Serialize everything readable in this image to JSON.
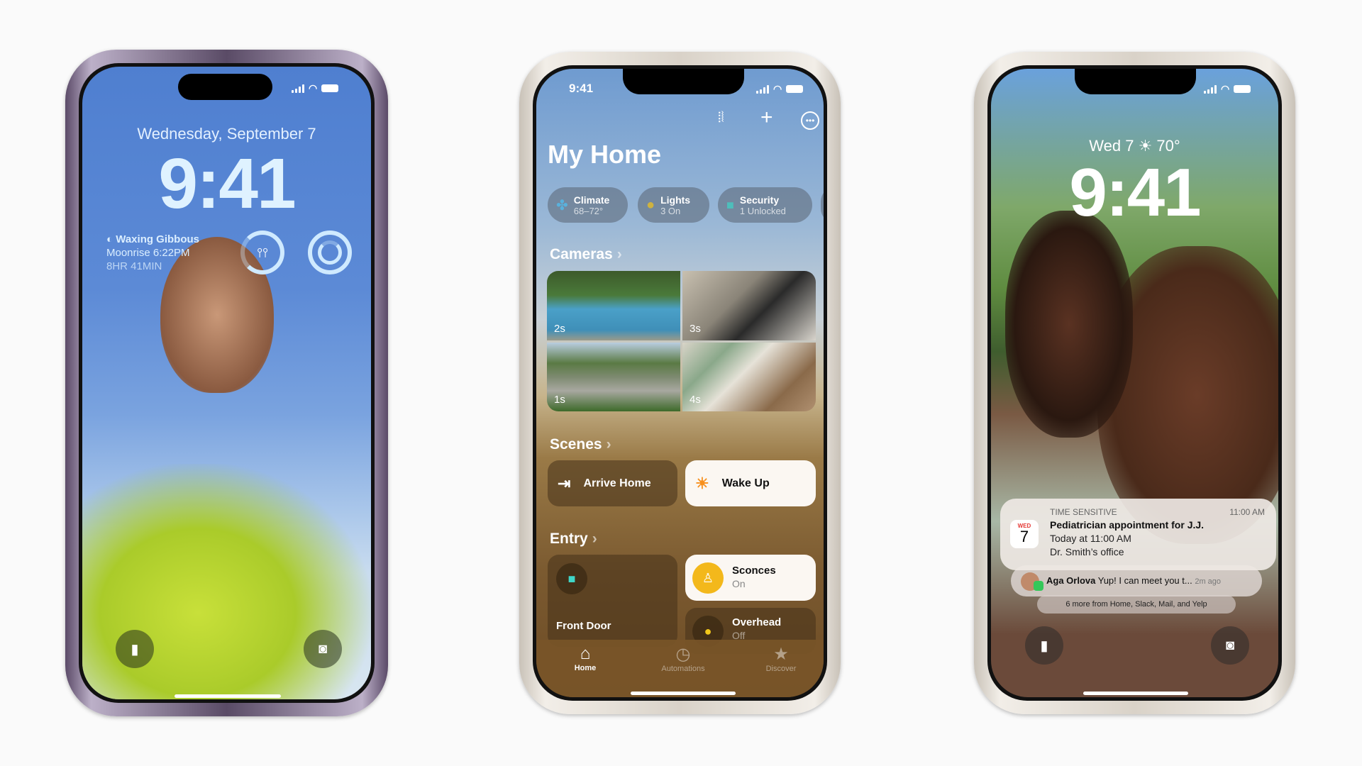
{
  "phone_left": {
    "date": "Wednesday, September 7",
    "time": "9:41",
    "widget": {
      "title": "Waxing Gibbous",
      "line2": "Moonrise 6:22PM",
      "line3": "8HR 41MIN"
    }
  },
  "phone_center": {
    "status_time": "9:41",
    "title": "My Home",
    "chips": [
      {
        "label": "Climate",
        "value": "68–72°",
        "icon": "fan-icon",
        "color": "#4fc3f7"
      },
      {
        "label": "Lights",
        "value": "3 On",
        "icon": "lightbulb-icon",
        "color": "#f5c518"
      },
      {
        "label": "Security",
        "value": "1 Unlocked",
        "icon": "lock-icon",
        "color": "#3fd6c8"
      }
    ],
    "cameras": {
      "header": "Cameras",
      "feeds": [
        {
          "age": "2s"
        },
        {
          "age": "3s"
        },
        {
          "age": "1s"
        },
        {
          "age": "4s"
        }
      ]
    },
    "scenes": {
      "header": "Scenes",
      "items": [
        {
          "label": "Arrive Home",
          "icon": "walking-person-icon"
        },
        {
          "label": "Wake Up",
          "icon": "sunrise-icon"
        }
      ]
    },
    "entry": {
      "header": "Entry",
      "front_door": "Front Door",
      "sconces": {
        "label": "Sconces",
        "state": "On"
      },
      "overhead": {
        "label": "Overhead",
        "state": "Off"
      }
    },
    "tabs": [
      {
        "label": "Home",
        "icon": "house-icon"
      },
      {
        "label": "Automations",
        "icon": "clock-icon"
      },
      {
        "label": "Discover",
        "icon": "star-icon"
      }
    ]
  },
  "phone_right": {
    "date_weather": "Wed 7 ☀ 70°",
    "time": "9:41",
    "notification": {
      "category": "TIME SENSITIVE",
      "time": "11:00 AM",
      "cal_day": "WED",
      "cal_date": "7",
      "title": "Pediatrician appointment for J.J.",
      "line2": "Today at 11:00 AM",
      "line3": "Dr. Smith’s office"
    },
    "message": {
      "sender": "Aga Orlova",
      "text": "Yup! I can meet you t...",
      "age": "2m ago"
    },
    "more": "6 more from Home, Slack, Mail, and Yelp"
  }
}
